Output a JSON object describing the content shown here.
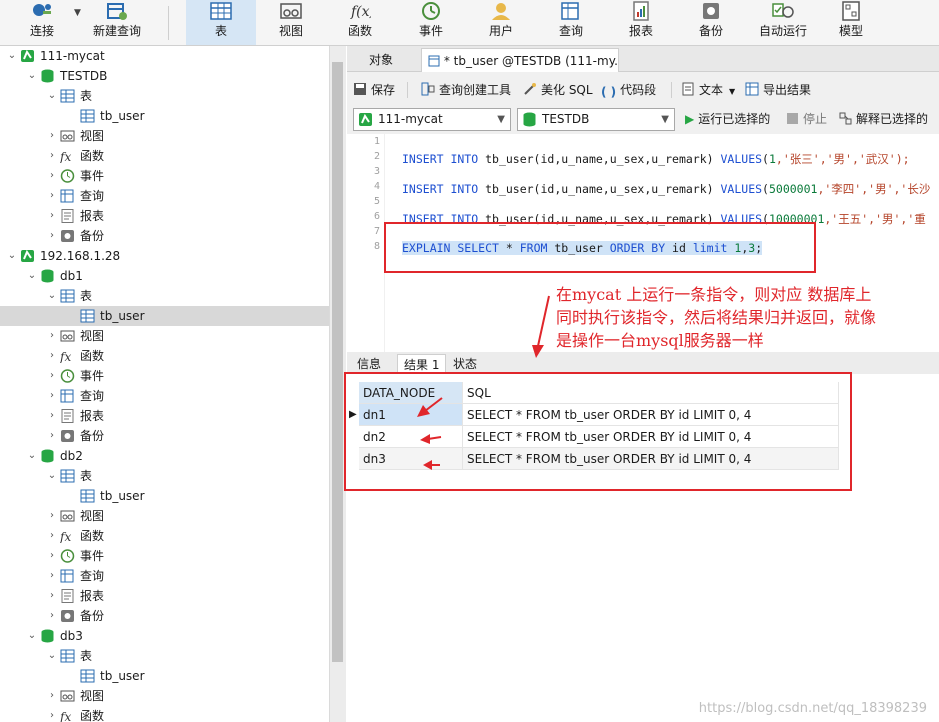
{
  "toolbar": {
    "items": [
      {
        "label": "连接",
        "icon": "connect-icon"
      },
      {
        "label": "新建查询",
        "icon": "new-query-icon"
      },
      {
        "label": "表",
        "icon": "table-icon"
      },
      {
        "label": "视图",
        "icon": "view-icon"
      },
      {
        "label": "函数",
        "icon": "function-icon"
      },
      {
        "label": "事件",
        "icon": "event-icon"
      },
      {
        "label": "用户",
        "icon": "user-icon"
      },
      {
        "label": "查询",
        "icon": "query-icon"
      },
      {
        "label": "报表",
        "icon": "report-icon"
      },
      {
        "label": "备份",
        "icon": "backup-icon"
      },
      {
        "label": "自动运行",
        "icon": "autorun-icon"
      },
      {
        "label": "模型",
        "icon": "model-icon"
      }
    ]
  },
  "sidebar": {
    "rows": [
      {
        "label": "111-mycat",
        "icon": "connection-icon"
      },
      {
        "label": "TESTDB",
        "icon": "database-icon"
      },
      {
        "label": "表",
        "icon": "table-icon"
      },
      {
        "label": "tb_user",
        "icon": "table-icon"
      },
      {
        "label": "视图",
        "icon": "view-icon"
      },
      {
        "label": "函数",
        "icon": "function-icon"
      },
      {
        "label": "事件",
        "icon": "event-icon"
      },
      {
        "label": "查询",
        "icon": "query-icon"
      },
      {
        "label": "报表",
        "icon": "report-icon"
      },
      {
        "label": "备份",
        "icon": "backup-icon"
      },
      {
        "label": "192.168.1.28",
        "icon": "connection-icon"
      },
      {
        "label": "db1",
        "icon": "database-icon"
      },
      {
        "label": "表",
        "icon": "table-icon"
      },
      {
        "label": "tb_user",
        "icon": "table-icon"
      },
      {
        "label": "视图",
        "icon": "view-icon"
      },
      {
        "label": "函数",
        "icon": "function-icon"
      },
      {
        "label": "事件",
        "icon": "event-icon"
      },
      {
        "label": "查询",
        "icon": "query-icon"
      },
      {
        "label": "报表",
        "icon": "report-icon"
      },
      {
        "label": "备份",
        "icon": "backup-icon"
      },
      {
        "label": "db2",
        "icon": "database-icon"
      },
      {
        "label": "表",
        "icon": "table-icon"
      },
      {
        "label": "tb_user",
        "icon": "table-icon"
      },
      {
        "label": "视图",
        "icon": "view-icon"
      },
      {
        "label": "函数",
        "icon": "function-icon"
      },
      {
        "label": "事件",
        "icon": "event-icon"
      },
      {
        "label": "查询",
        "icon": "query-icon"
      },
      {
        "label": "报表",
        "icon": "report-icon"
      },
      {
        "label": "备份",
        "icon": "backup-icon"
      },
      {
        "label": "db3",
        "icon": "database-icon"
      },
      {
        "label": "表",
        "icon": "table-icon"
      },
      {
        "label": "tb_user",
        "icon": "table-icon"
      },
      {
        "label": "视图",
        "icon": "view-icon"
      },
      {
        "label": "函数",
        "icon": "function-icon"
      }
    ]
  },
  "tabs": {
    "objects": "对象",
    "query": "* tb_user @TESTDB (111-my..."
  },
  "actions": {
    "save": "保存",
    "query_builder": "查询创建工具",
    "beautify": "美化 SQL",
    "snippet": "代码段",
    "text": "文本",
    "export": "导出结果"
  },
  "selects": {
    "connection": "111-mycat",
    "database": "TESTDB",
    "run_selected": "运行已选择的",
    "stop": "停止",
    "explain_selected": "解释已选择的"
  },
  "editor": {
    "line_numbers": [
      "1",
      "2",
      "3",
      "4",
      "5",
      "6",
      "7",
      "8"
    ],
    "lines": [
      {
        "n": "2",
        "kw1": "INSERT INTO",
        "p1": " tb_user(id,u_name,u_sex,u_remark) ",
        "kw2": "VALUES",
        "p2": "(",
        "num": "1",
        "rest": ",'张三','男','武汉');"
      },
      {
        "n": "4",
        "kw1": "INSERT INTO",
        "p1": " tb_user(id,u_name,u_sex,u_remark) ",
        "kw2": "VALUES",
        "p2": "(",
        "num": "5000001",
        "rest": ",'李四','男','长沙"
      },
      {
        "n": "6",
        "kw1": "INSERT INTO",
        "p1": " tb_user(id,u_name,u_sex,u_remark) ",
        "kw2": "VALUES",
        "p2": "(",
        "num": "10000001",
        "rest": ",'王五','男','重"
      }
    ],
    "explain": {
      "kw1": "EXPLAIN SELECT",
      "p1": " * ",
      "kw2": "FROM",
      "p2": "  tb_user ",
      "kw3": "ORDER BY",
      "p3": " id ",
      "kw4": "limit",
      "p4": " ",
      "num1": "1",
      "p5": ",",
      "num2": "3",
      "p6": ";"
    }
  },
  "annotation": {
    "line1": "在mycat 上运行一条指令，则对应 数据库上",
    "line2": "同时执行该指令，然后将结果归并返回，就像",
    "line3": "是操作一台mysql服务器一样",
    "color": "#e0262b"
  },
  "result_tabs": [
    "信息",
    "结果 1",
    "状态"
  ],
  "results": {
    "columns": [
      "DATA_NODE",
      "SQL"
    ],
    "rows": [
      [
        "dn1",
        "SELECT * FROM tb_user ORDER BY id LIMIT 0, 4"
      ],
      [
        "dn2",
        "SELECT * FROM tb_user ORDER BY id LIMIT 0, 4"
      ],
      [
        "dn3",
        "SELECT * FROM tb_user ORDER BY id LIMIT 0, 4"
      ]
    ]
  },
  "watermark": "https://blog.csdn.net/qq_18398239"
}
